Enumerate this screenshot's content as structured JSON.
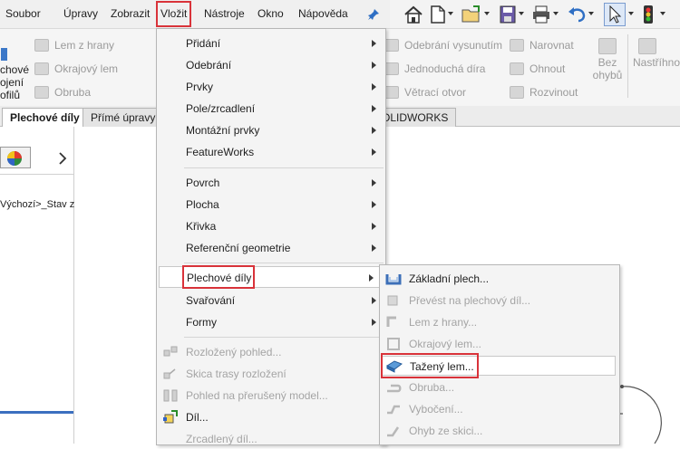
{
  "menubar": {
    "items": [
      {
        "label": "Soubor"
      },
      {
        "label": "Úpravy"
      },
      {
        "label": "Zobrazit"
      },
      {
        "label": "Vložit",
        "active": true
      },
      {
        "label": "Nástroje"
      },
      {
        "label": "Okno"
      },
      {
        "label": "Nápověda"
      }
    ],
    "pin_icon": "pin-icon"
  },
  "quickbar": {
    "icons": [
      "home-icon",
      "new-document-icon",
      "open-folder-icon",
      "save-icon",
      "print-icon",
      "undo-icon",
      "select-cursor-icon",
      "traffic-light-icon"
    ]
  },
  "ribbon": {
    "left_fragment": [
      "chové",
      "ojení",
      "ofilů"
    ],
    "col1": [
      "Lem z hrany",
      "Okrajový lem",
      "Obruba"
    ],
    "col2": [
      "Odebrání vysunutím",
      "Jednoduchá díra",
      "Větrací otvor"
    ],
    "col3": [
      "Narovnat",
      "Ohnout",
      "Rozvinout"
    ],
    "big_button": [
      "Bez",
      "ohybů"
    ],
    "right_fragment": "Nastříhno"
  },
  "tabs": [
    {
      "label": "Plechové díly",
      "active": true
    },
    {
      "label": "Přímé úpravy"
    },
    {
      "label": "OLIDWORKS"
    }
  ],
  "left_panel": {
    "tree_text": "Výchozí>_Stav z"
  },
  "insert_menu": {
    "items": [
      {
        "label": "Přidání",
        "submenu": true
      },
      {
        "label": "Odebrání",
        "submenu": true
      },
      {
        "label": "Prvky",
        "submenu": true
      },
      {
        "label": "Pole/zrcadlení",
        "submenu": true
      },
      {
        "label": "Montážní prvky",
        "submenu": true
      },
      {
        "label": "FeatureWorks",
        "submenu": true
      },
      {
        "label": "Povrch",
        "submenu": true
      },
      {
        "label": "Plocha",
        "submenu": true
      },
      {
        "label": "Křivka",
        "submenu": true
      },
      {
        "label": "Referenční geometrie",
        "submenu": true
      },
      {
        "label": "Plechové díly",
        "submenu": true,
        "highlighted": true
      },
      {
        "label": "Svařování",
        "submenu": true
      },
      {
        "label": "Formy",
        "submenu": true
      },
      {
        "label": "Rozložený pohled...",
        "disabled": true
      },
      {
        "label": "Skica trasy rozložení",
        "disabled": true
      },
      {
        "label": "Pohled na přerušený model...",
        "disabled": true
      },
      {
        "label": "Díl..."
      },
      {
        "label": "Zrcadlený díl...",
        "disabled": true
      }
    ]
  },
  "sheetmetal_submenu": {
    "items": [
      {
        "label": "Základní plech..."
      },
      {
        "label": "Převést na plechový díl...",
        "disabled": true
      },
      {
        "label": "Lem z hrany...",
        "disabled": true
      },
      {
        "label": "Okrajový lem...",
        "disabled": true
      },
      {
        "label": "Tažený lem...",
        "highlighted": true
      },
      {
        "label": "Obruba...",
        "disabled": true
      },
      {
        "label": "Vybočení...",
        "disabled": true
      },
      {
        "label": "Ohyb ze skici...",
        "disabled": true
      }
    ]
  },
  "colors": {
    "highlight_border": "#d9333a",
    "disabled_text": "#a4a4a4",
    "menu_background": "#f4f4f4"
  }
}
